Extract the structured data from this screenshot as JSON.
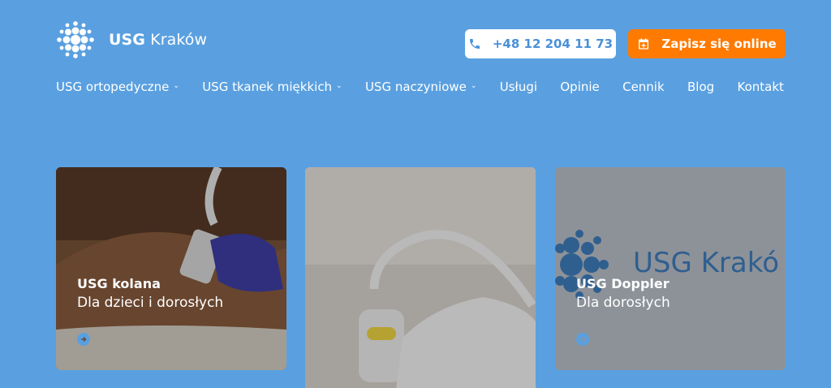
{
  "header": {
    "logo": {
      "brand": "USG",
      "city": "Kraków"
    },
    "phone_label": "+48 12 204 11 73",
    "book_label": "Zapisz się online"
  },
  "nav": {
    "items": [
      {
        "label": "USG ortopedyczne",
        "dropdown": true
      },
      {
        "label": "USG tkanek miękkich",
        "dropdown": true
      },
      {
        "label": "USG naczyniowe",
        "dropdown": true
      },
      {
        "label": "Usługi",
        "dropdown": false
      },
      {
        "label": "Opinie",
        "dropdown": false
      },
      {
        "label": "Cennik",
        "dropdown": false
      },
      {
        "label": "Blog",
        "dropdown": false
      },
      {
        "label": "Kontakt",
        "dropdown": false
      }
    ],
    "dropdown_glyph": "⌄"
  },
  "cards": [
    {
      "title": "USG kolana",
      "subtitle": "Dla dzieci i dorosłych"
    },
    {
      "title": "",
      "subtitle": ""
    },
    {
      "title": "USG Doppler",
      "subtitle": "Dla dorosłych",
      "watermark": "USG Krakó"
    }
  ],
  "colors": {
    "background": "#5aa0e0",
    "accent_orange": "#ff7a00",
    "primary_blue": "#4a90d9"
  },
  "icons": [
    "logo-dots-icon",
    "phone-icon",
    "calendar-plus-icon",
    "arrow-right-circle-icon"
  ]
}
